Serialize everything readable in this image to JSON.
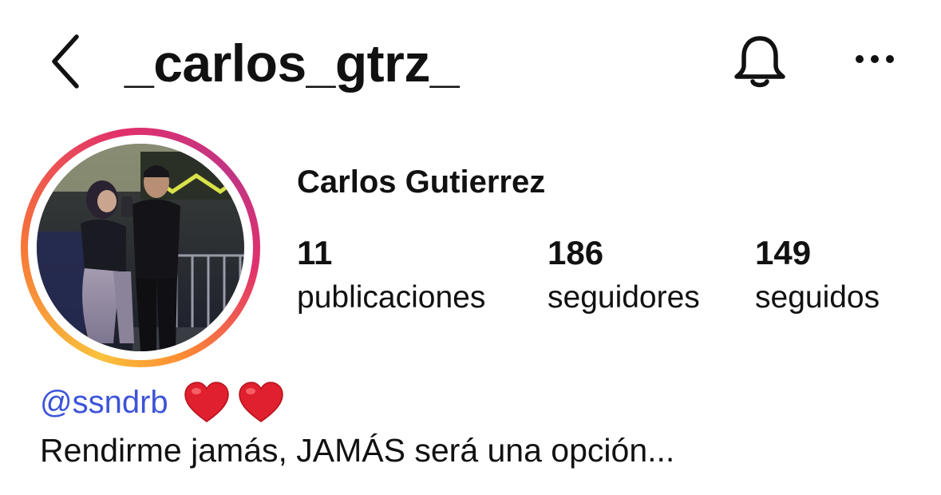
{
  "header": {
    "username": "_carlos_gtrz_",
    "back_icon": "chevron-left-icon",
    "notification_icon": "bell-icon",
    "more_icon": "ellipsis-icon"
  },
  "profile": {
    "full_name": "Carlos Gutierrez",
    "avatar": "story-ring-avatar",
    "story_ring_colors": [
      "#f9c23c",
      "#f77737",
      "#e1306c",
      "#c13584"
    ]
  },
  "stats": {
    "posts": {
      "value": "11",
      "label": "publicaciones"
    },
    "followers": {
      "value": "186",
      "label": "seguidores"
    },
    "following": {
      "value": "149",
      "label": "seguidos"
    }
  },
  "bio": {
    "mention": "@ssndrb",
    "emoji": [
      "heart-icon",
      "heart-icon"
    ],
    "text": "Rendirme jamás, JAMÁS será una opción...",
    "mention_color": "#3d54d8"
  }
}
